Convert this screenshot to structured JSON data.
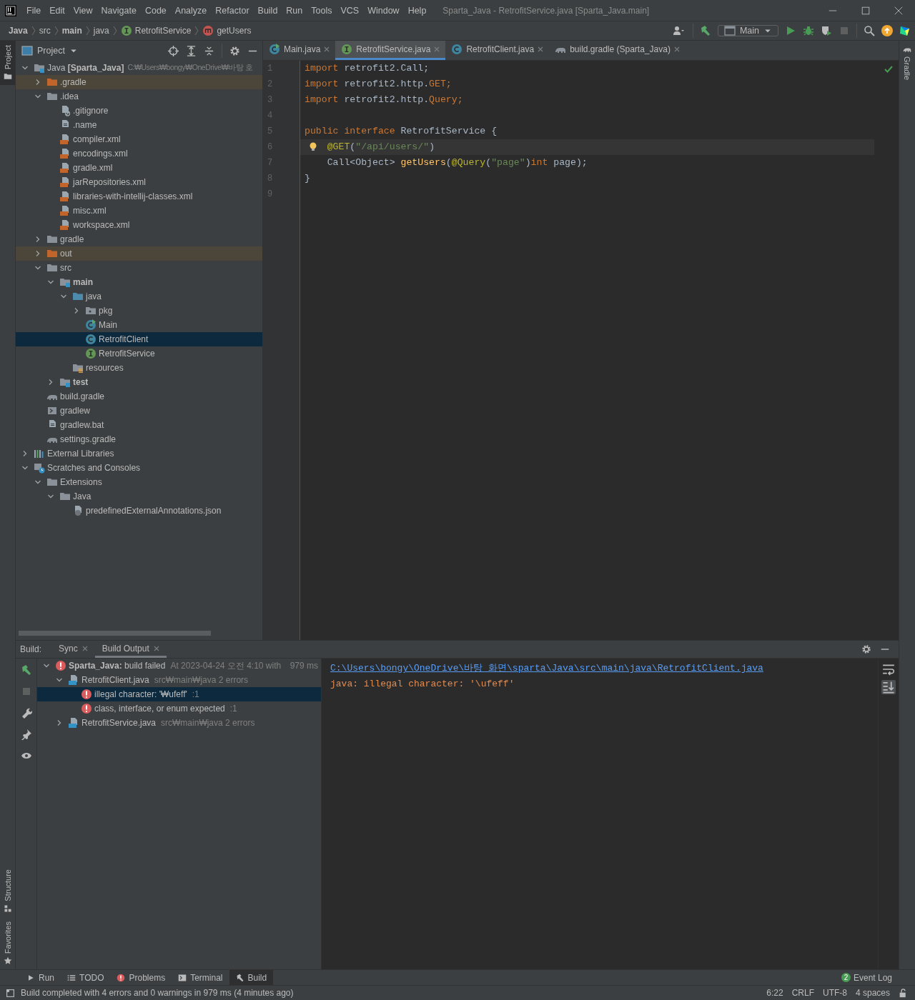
{
  "window": {
    "title": "Sparta_Java - RetrofitService.java [Sparta_Java.main]"
  },
  "menu": [
    "File",
    "Edit",
    "View",
    "Navigate",
    "Code",
    "Analyze",
    "Refactor",
    "Build",
    "Run",
    "Tools",
    "VCS",
    "Window",
    "Help"
  ],
  "breadcrumbs": [
    {
      "label": "Java",
      "kind": "module"
    },
    {
      "label": "src",
      "kind": "folder"
    },
    {
      "label": "main",
      "kind": "source-root"
    },
    {
      "label": "java",
      "kind": "folder"
    },
    {
      "label": "RetrofitService",
      "kind": "interface"
    },
    {
      "label": "getUsers",
      "kind": "method"
    }
  ],
  "run_config": {
    "label": "Main"
  },
  "left_stripe": [
    {
      "label": "Project",
      "selected": true,
      "kind": "project"
    },
    {
      "label": "Structure",
      "selected": false,
      "kind": "structure"
    },
    {
      "label": "Favorites",
      "selected": false,
      "kind": "favorites"
    }
  ],
  "right_stripe": [
    {
      "label": "Gradle",
      "selected": false
    }
  ],
  "project": {
    "title": "Project",
    "tree": [
      {
        "label": "Java **[Sparta_Java]**",
        "path": "C:₩Users₩bongy₩OneDrive₩바탕 호",
        "kind": "module",
        "expanded": true,
        "selected": false,
        "children": [
          {
            "label": ".gradle",
            "kind": "excluded-folder",
            "expanded": false,
            "selected": false
          },
          {
            "label": ".idea",
            "kind": "folder",
            "expanded": true,
            "selected": false,
            "children": [
              {
                "label": ".gitignore",
                "kind": "ignore-file",
                "selected": false
              },
              {
                "label": ".name",
                "kind": "text-file",
                "selected": false
              },
              {
                "label": "compiler.xml",
                "kind": "xml-file",
                "selected": false
              },
              {
                "label": "encodings.xml",
                "kind": "xml-file",
                "selected": false
              },
              {
                "label": "gradle.xml",
                "kind": "xml-file",
                "selected": false
              },
              {
                "label": "jarRepositories.xml",
                "kind": "xml-file",
                "selected": false
              },
              {
                "label": "libraries-with-intellij-classes.xml",
                "kind": "xml-file",
                "selected": false
              },
              {
                "label": "misc.xml",
                "kind": "xml-file",
                "selected": false
              },
              {
                "label": "workspace.xml",
                "kind": "xml-file",
                "selected": false
              }
            ]
          },
          {
            "label": "gradle",
            "kind": "folder",
            "expanded": false,
            "selected": false
          },
          {
            "label": "out",
            "kind": "excluded-folder",
            "expanded": false,
            "selected": false
          },
          {
            "label": "src",
            "kind": "folder",
            "expanded": true,
            "selected": false,
            "children": [
              {
                "label": "main",
                "kind": "source-root",
                "expanded": true,
                "selected": false,
                "children": [
                  {
                    "label": "java",
                    "kind": "java-source",
                    "expanded": true,
                    "selected": false,
                    "children": [
                      {
                        "label": "pkg",
                        "kind": "package",
                        "expanded": false,
                        "selected": false
                      },
                      {
                        "label": "Main",
                        "kind": "main-class",
                        "selected": false
                      },
                      {
                        "label": "RetrofitClient",
                        "kind": "class",
                        "selected": true
                      },
                      {
                        "label": "RetrofitService",
                        "kind": "interface",
                        "selected": false
                      }
                    ]
                  },
                  {
                    "label": "resources",
                    "kind": "resources",
                    "selected": false
                  }
                ]
              },
              {
                "label": "test",
                "kind": "source-root",
                "expanded": false,
                "selected": false
              }
            ]
          },
          {
            "label": "build.gradle",
            "kind": "gradle-file",
            "selected": false
          },
          {
            "label": "gradlew",
            "kind": "shell-file",
            "selected": false
          },
          {
            "label": "gradlew.bat",
            "kind": "text-file",
            "selected": false
          },
          {
            "label": "settings.gradle",
            "kind": "gradle-file",
            "selected": false
          }
        ]
      },
      {
        "label": "External Libraries",
        "kind": "libraries",
        "expanded": false,
        "selected": false
      },
      {
        "label": "Scratches and Consoles",
        "kind": "scratches",
        "expanded": true,
        "selected": false,
        "children": [
          {
            "label": "Extensions",
            "kind": "folder",
            "expanded": true,
            "selected": false,
            "children": [
              {
                "label": "Java",
                "kind": "folder",
                "expanded": true,
                "selected": false,
                "children": [
                  {
                    "label": "predefinedExternalAnnotations.json",
                    "kind": "json-file",
                    "selected": false
                  }
                ]
              }
            ]
          }
        ]
      }
    ]
  },
  "editor": {
    "tabs": [
      {
        "label": "Main.java",
        "kind": "main-class",
        "selected": false
      },
      {
        "label": "RetrofitService.java",
        "kind": "interface",
        "selected": true
      },
      {
        "label": "RetrofitClient.java",
        "kind": "class",
        "selected": false
      },
      {
        "label": "build.gradle (Sparta_Java)",
        "kind": "gradle-file",
        "selected": false
      }
    ],
    "lines": [
      {
        "number": "1",
        "current": false,
        "tokens": [
          {
            "text": "import",
            "kind": "keyword"
          },
          {
            "text": " retrofit2.Call;",
            "kind": "plain"
          }
        ]
      },
      {
        "number": "2",
        "current": false,
        "tokens": [
          {
            "text": "import",
            "kind": "keyword"
          },
          {
            "text": " retrofit2.http.",
            "kind": "plain"
          },
          {
            "text": "GET",
            "kind": "keyword"
          },
          {
            "text": ";",
            "kind": "keyword"
          }
        ]
      },
      {
        "number": "3",
        "current": false,
        "tokens": [
          {
            "text": "import",
            "kind": "keyword"
          },
          {
            "text": " retrofit2.http.",
            "kind": "plain"
          },
          {
            "text": "Query",
            "kind": "keyword"
          },
          {
            "text": ";",
            "kind": "keyword"
          }
        ]
      },
      {
        "number": "4",
        "current": false
      },
      {
        "number": "5",
        "current": false,
        "tokens": [
          {
            "text": "public interface",
            "kind": "keyword"
          },
          {
            "text": " RetrofitService {",
            "kind": "plain"
          }
        ]
      },
      {
        "number": "6",
        "current": true,
        "tokens": [
          {
            "text": "    @GET",
            "kind": "annotation"
          },
          {
            "text": "(",
            "kind": "plain"
          },
          {
            "text": "\"/api/users/\"",
            "kind": "string"
          },
          {
            "text": ")",
            "kind": "plain"
          }
        ]
      },
      {
        "number": "7",
        "current": false,
        "tokens": [
          {
            "text": "    Call<Object> ",
            "kind": "plain"
          },
          {
            "text": "getUsers",
            "kind": "method"
          },
          {
            "text": "(",
            "kind": "plain"
          },
          {
            "text": "@Query",
            "kind": "annotation"
          },
          {
            "text": "(",
            "kind": "plain"
          },
          {
            "text": "\"page\"",
            "kind": "string"
          },
          {
            "text": ")",
            "kind": "plain"
          },
          {
            "text": "int",
            "kind": "keyword"
          },
          {
            "text": " page);",
            "kind": "plain"
          }
        ]
      },
      {
        "number": "8",
        "current": false,
        "tokens": [
          {
            "text": "}",
            "kind": "plain"
          }
        ]
      },
      {
        "number": "9",
        "current": false
      }
    ]
  },
  "build": {
    "title": "Build:",
    "tabs": [
      {
        "label": "Sync",
        "selected": false
      },
      {
        "label": "Build Output",
        "selected": true
      }
    ],
    "tree": [
      {
        "label": "**Sparta_Java:** build failed",
        "detail": "At 2023-04-24 오전 4:10 with",
        "duration": "979 ms",
        "kind": "error",
        "expanded": true,
        "selected": false,
        "children": [
          {
            "label": "RetrofitClient.java",
            "detail": "src₩main₩java 2 errors",
            "kind": "java-file",
            "expanded": true,
            "selected": false,
            "children": [
              {
                "label": "illegal character: '₩ufeff'",
                "detail": ":1",
                "kind": "error",
                "selected": true
              },
              {
                "label": "class, interface, or enum expected",
                "detail": ":1",
                "kind": "error",
                "selected": false
              }
            ]
          },
          {
            "label": "RetrofitService.java",
            "detail": "src₩main₩java 2 errors",
            "kind": "java-file",
            "expanded": false,
            "selected": false
          }
        ]
      }
    ],
    "console": [
      {
        "text": "C:\\Users\\bongy\\OneDrive\\바탕 화면\\sparta\\Java\\src\\main\\java\\RetrofitClient.java",
        "kind": "link"
      },
      {
        "text": "java: illegal character: '\\ufeff'",
        "kind": "error"
      }
    ]
  },
  "tool_tabs": [
    {
      "label": "Run",
      "kind": "run",
      "selected": false
    },
    {
      "label": "TODO",
      "kind": "todo",
      "selected": false
    },
    {
      "label": "Problems",
      "kind": "problems",
      "selected": false
    },
    {
      "label": "Terminal",
      "kind": "terminal",
      "selected": false
    },
    {
      "label": "Build",
      "kind": "build",
      "selected": true
    }
  ],
  "event_log": {
    "badge": "2",
    "label": "Event Log"
  },
  "status_bar": {
    "message": "Build completed with 4 errors and 0 warnings in 979 ms (4 minutes ago)",
    "items": [
      "6:22",
      "CRLF",
      "UTF-8",
      "4 spaces"
    ]
  }
}
